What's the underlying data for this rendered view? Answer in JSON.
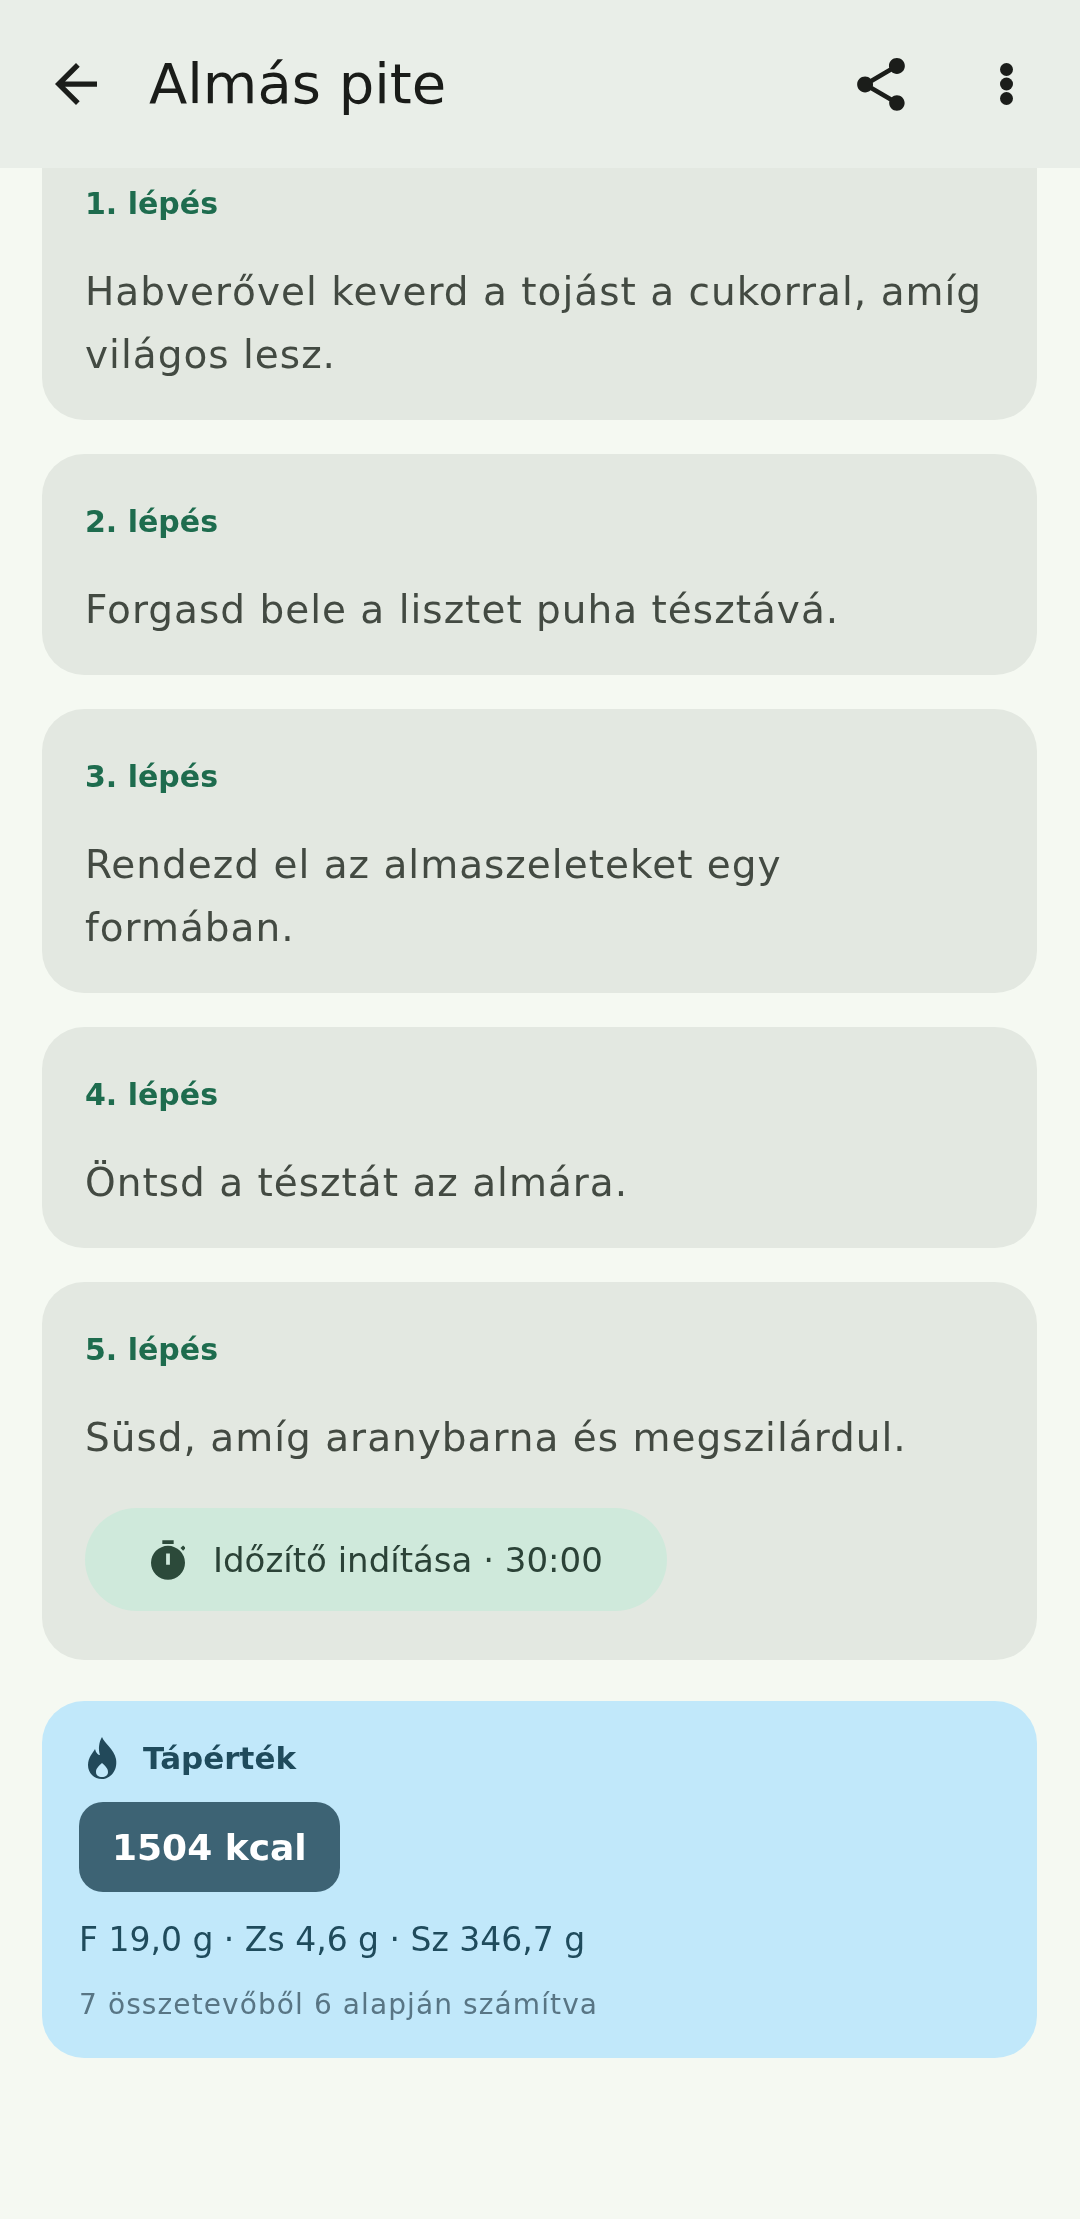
{
  "app_bar": {
    "title": "Almás pite"
  },
  "steps": [
    {
      "label": "1. lépés",
      "text": "Habverővel keverd a tojást a cukorral, amíg világos lesz."
    },
    {
      "label": "2. lépés",
      "text": "Forgasd bele a lisztet puha tésztává."
    },
    {
      "label": "3. lépés",
      "text": "Rendezd el az almaszeleteket egy formában."
    },
    {
      "label": "4. lépés",
      "text": "Öntsd a tésztát az almára."
    },
    {
      "label": "5. lépés",
      "text": "Süsd, amíg aranybarna és megszilárdul.",
      "timer": {
        "label": "Időzítő indítása · 30:00"
      }
    }
  ],
  "nutrition": {
    "title": "Tápérték",
    "calories": "1504 kcal",
    "macros": "F 19,0 g · Zs 4,6 g · Sz 346,7 g",
    "note": "7 összetevőből 6 alapján számítva"
  }
}
